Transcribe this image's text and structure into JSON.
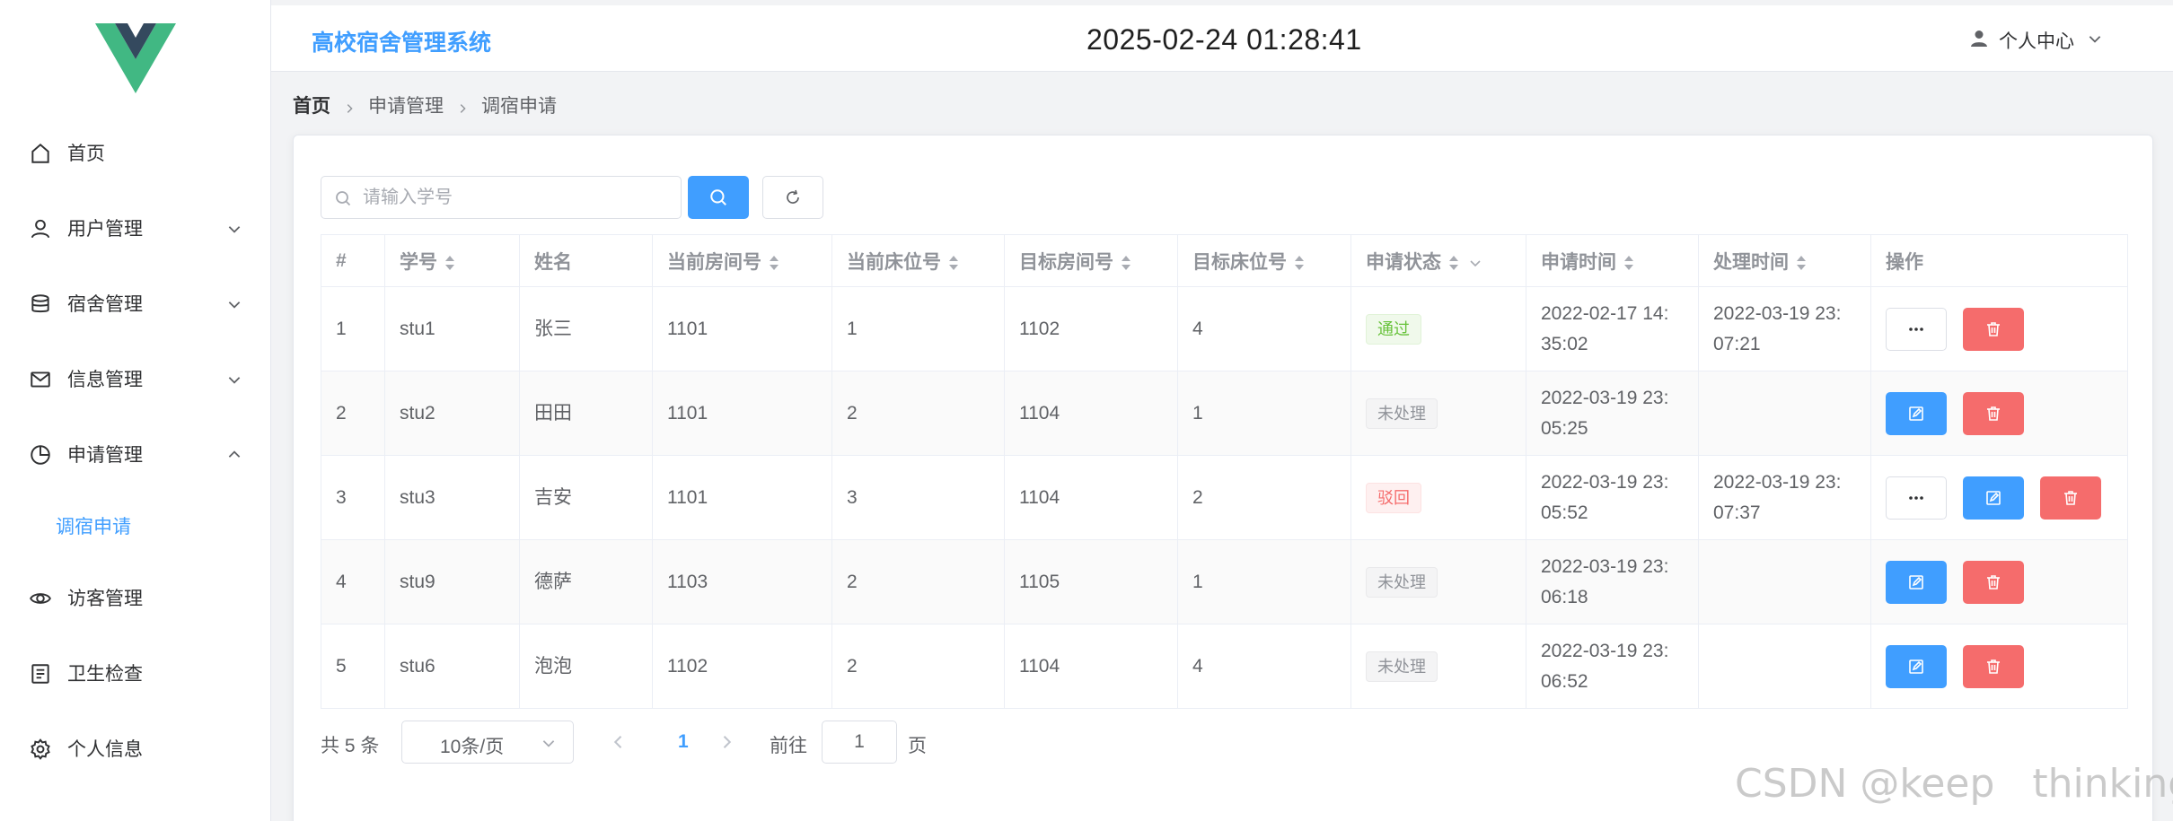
{
  "header": {
    "system_title": "高校宿舍管理系统",
    "datetime": "2025-02-24 01:28:41",
    "user_center_label": "个人中心"
  },
  "sidebar": {
    "items": [
      {
        "label": "首页",
        "icon": "home-icon"
      },
      {
        "label": "用户管理",
        "icon": "user-icon",
        "expandable": true
      },
      {
        "label": "宿舍管理",
        "icon": "database-icon",
        "expandable": true
      },
      {
        "label": "信息管理",
        "icon": "mail-icon",
        "expandable": true
      },
      {
        "label": "申请管理",
        "icon": "pie-chart-icon",
        "expandable": true,
        "expanded": true
      },
      {
        "label": "访客管理",
        "icon": "eye-icon"
      },
      {
        "label": "卫生检查",
        "icon": "document-icon"
      },
      {
        "label": "个人信息",
        "icon": "gear-icon"
      }
    ],
    "active_subitem": "调宿申请"
  },
  "breadcrumb": {
    "home": "首页",
    "level1": "申请管理",
    "level2": "调宿申请"
  },
  "search": {
    "placeholder": "请输入学号",
    "value": ""
  },
  "table": {
    "columns": [
      "#",
      "学号",
      "姓名",
      "当前房间号",
      "当前床位号",
      "目标房间号",
      "目标床位号",
      "申请状态",
      "申请时间",
      "处理时间",
      "操作"
    ],
    "rows": [
      {
        "index": "1",
        "student_id": "stu1",
        "name": "张三",
        "cur_room": "1101",
        "cur_bed": "1",
        "target_room": "1102",
        "target_bed": "4",
        "status": "通过",
        "status_type": "pass",
        "apply_time_1": "2022-02-17 14:",
        "apply_time_2": "35:02",
        "handle_time_1": "2022-03-19 23:",
        "handle_time_2": "07:21",
        "ops": [
          "more",
          "delete"
        ]
      },
      {
        "index": "2",
        "student_id": "stu2",
        "name": "田田",
        "cur_room": "1101",
        "cur_bed": "2",
        "target_room": "1104",
        "target_bed": "1",
        "status": "未处理",
        "status_type": "pending",
        "apply_time_1": "2022-03-19 23:",
        "apply_time_2": "05:25",
        "handle_time_1": "",
        "handle_time_2": "",
        "ops": [
          "edit",
          "delete"
        ]
      },
      {
        "index": "3",
        "student_id": "stu3",
        "name": "吉安",
        "cur_room": "1101",
        "cur_bed": "3",
        "target_room": "1104",
        "target_bed": "2",
        "status": "驳回",
        "status_type": "reject",
        "apply_time_1": "2022-03-19 23:",
        "apply_time_2": "05:52",
        "handle_time_1": "2022-03-19 23:",
        "handle_time_2": "07:37",
        "ops": [
          "more",
          "edit",
          "delete"
        ]
      },
      {
        "index": "4",
        "student_id": "stu9",
        "name": "德萨",
        "cur_room": "1103",
        "cur_bed": "2",
        "target_room": "1105",
        "target_bed": "1",
        "status": "未处理",
        "status_type": "pending",
        "apply_time_1": "2022-03-19 23:",
        "apply_time_2": "06:18",
        "handle_time_1": "",
        "handle_time_2": "",
        "ops": [
          "edit",
          "delete"
        ]
      },
      {
        "index": "5",
        "student_id": "stu6",
        "name": "泡泡",
        "cur_room": "1102",
        "cur_bed": "2",
        "target_room": "1104",
        "target_bed": "4",
        "status": "未处理",
        "status_type": "pending",
        "apply_time_1": "2022-03-19 23:",
        "apply_time_2": "06:52",
        "handle_time_1": "",
        "handle_time_2": "",
        "ops": [
          "edit",
          "delete"
        ]
      }
    ]
  },
  "pagination": {
    "total": "共 5 条",
    "page_size": "10条/页",
    "current_page": "1",
    "goto_label": "前往",
    "goto_value": "1",
    "page_unit": "页"
  },
  "watermark": "CSDN @keep   thinking",
  "colors": {
    "primary": "#409eff",
    "danger": "#f56c6c",
    "success": "#67c23a",
    "info": "#909399",
    "logo_green": "#41b883",
    "logo_dark": "#34495e"
  }
}
